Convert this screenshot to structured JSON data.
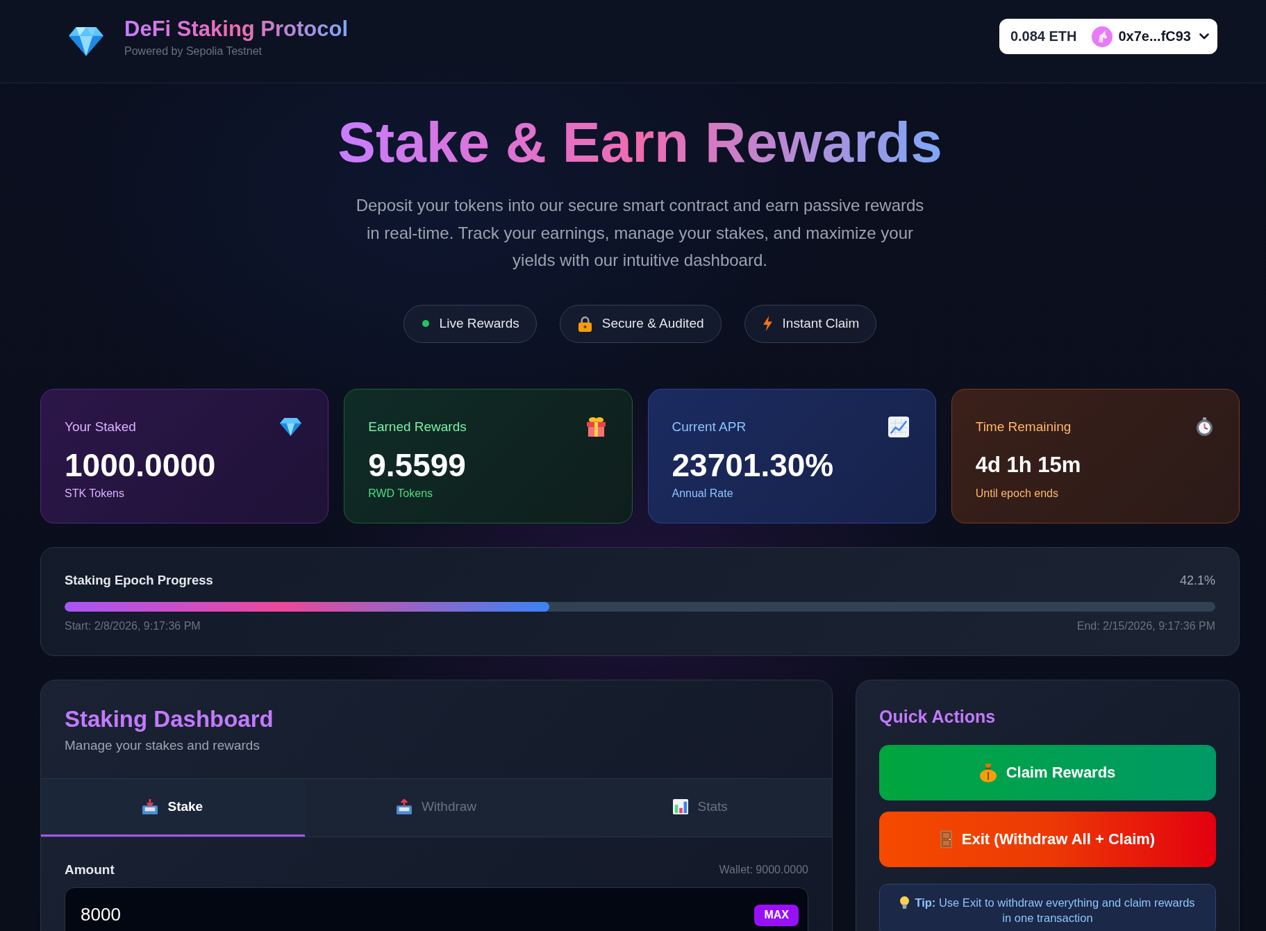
{
  "header": {
    "title": "DeFi Staking Protocol",
    "subtitle": "Powered by Sepolia Testnet",
    "wallet": {
      "balance": "0.084 ETH",
      "address": "0x7e...fC93"
    }
  },
  "hero": {
    "title": "Stake & Earn Rewards",
    "description": "Deposit your tokens into our secure smart contract and earn passive rewards in real-time. Track your earnings, manage your stakes, and maximize your yields with our intuitive dashboard.",
    "badges": [
      {
        "kind": "live",
        "label": "Live Rewards"
      },
      {
        "kind": "lock",
        "label": "Secure & Audited"
      },
      {
        "kind": "bolt",
        "label": "Instant Claim"
      }
    ]
  },
  "stats": [
    {
      "kind": "staked",
      "label": "Your Staked",
      "value": "1000.0000",
      "unit": "STK Tokens"
    },
    {
      "kind": "rewards",
      "label": "Earned Rewards",
      "value": "9.5599",
      "unit": "RWD Tokens"
    },
    {
      "kind": "apr",
      "label": "Current APR",
      "value": "23701.30%",
      "unit": "Annual Rate"
    },
    {
      "kind": "time",
      "label": "Time Remaining",
      "value": "4d 1h 15m",
      "unit": "Until epoch ends"
    }
  ],
  "progress": {
    "title": "Staking Epoch Progress",
    "percent": "42.1%",
    "level": 0.421,
    "start": "Start: 2/8/2026, 9:17:36 PM",
    "end": "End: 2/15/2026, 9:17:36 PM"
  },
  "dashboard": {
    "title": "Staking Dashboard",
    "subtitle": "Manage your stakes and rewards",
    "tabs": [
      {
        "kind": "stake",
        "label": "Stake",
        "selected": true
      },
      {
        "kind": "withdraw",
        "label": "Withdraw",
        "selected": false
      },
      {
        "kind": "stats",
        "label": "Stats",
        "selected": false
      }
    ],
    "amount_label": "Amount",
    "wallet_balance": "Wallet: 9000.0000",
    "amount": "8000",
    "max_button": "MAX"
  },
  "quick_actions": {
    "title": "Quick Actions",
    "buttons": [
      {
        "kind": "claim",
        "label": "Claim Rewards"
      },
      {
        "kind": "exit",
        "label": "Exit (Withdraw All + Claim)"
      }
    ],
    "tip": "**Tip:** Use Exit to withdraw everything and claim rewards in one transaction"
  }
}
